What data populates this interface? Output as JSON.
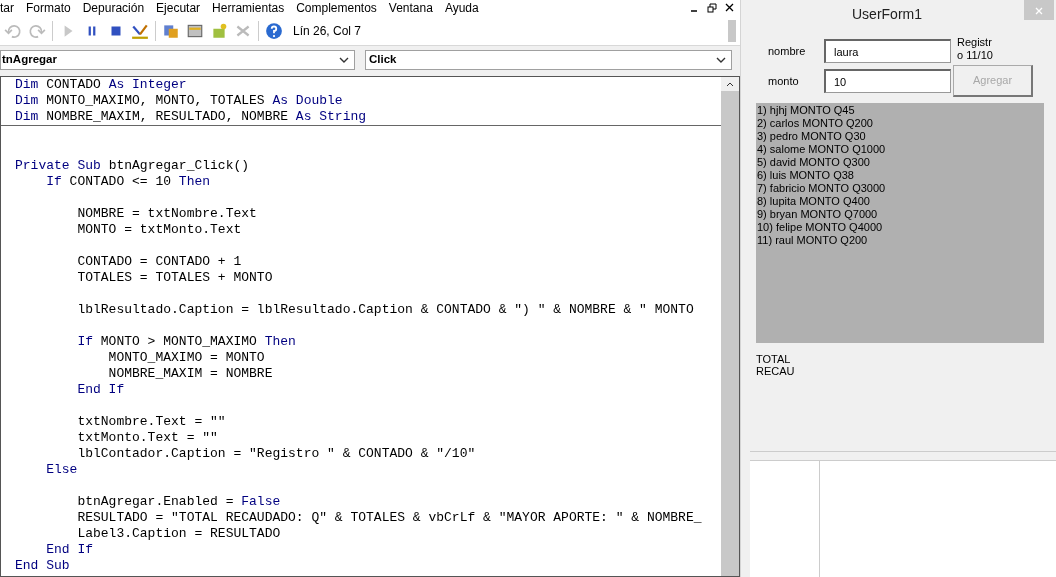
{
  "menu": [
    "tar",
    "Formato",
    "Depuración",
    "Ejecutar",
    "Herramientas",
    "Complementos",
    "Ventana",
    "Ayuda"
  ],
  "toolbar": {
    "position": "Lín 26, Col 7"
  },
  "object_dropdown": {
    "value": "tnAgregar"
  },
  "procedure_dropdown": {
    "value": "Click"
  },
  "code": {
    "declarations": [
      {
        "kind": "code",
        "tokens": [
          {
            "t": "Dim",
            "kind": "keyword"
          },
          {
            "t": " CONTADO ",
            "kind": "plain"
          },
          {
            "t": "As Integer",
            "kind": "keyword"
          }
        ]
      },
      {
        "kind": "code",
        "tokens": [
          {
            "t": "Dim",
            "kind": "keyword"
          },
          {
            "t": " MONTO_MAXIMO, MONTO, TOTALES ",
            "kind": "plain"
          },
          {
            "t": "As Double",
            "kind": "keyword"
          }
        ]
      },
      {
        "kind": "code",
        "tokens": [
          {
            "t": "Dim",
            "kind": "keyword"
          },
          {
            "t": " NOMBRE_MAXIM, RESULTADO, NOMBRE ",
            "kind": "plain"
          },
          {
            "t": "As String",
            "kind": "keyword"
          }
        ]
      }
    ],
    "procedure": [
      {
        "kind": "blank"
      },
      {
        "kind": "blank"
      },
      {
        "kind": "code",
        "tokens": [
          {
            "t": "Private Sub",
            "kind": "keyword"
          },
          {
            "t": " btnAgregar_Click()",
            "kind": "plain"
          }
        ]
      },
      {
        "kind": "code",
        "tokens": [
          {
            "t": "    If",
            "kind": "keyword"
          },
          {
            "t": " CONTADO <= 10 ",
            "kind": "plain"
          },
          {
            "t": "Then",
            "kind": "keyword"
          }
        ]
      },
      {
        "kind": "blank"
      },
      {
        "kind": "code",
        "tokens": [
          {
            "t": "        NOMBRE = txtNombre.Text",
            "kind": "plain"
          }
        ]
      },
      {
        "kind": "code",
        "tokens": [
          {
            "t": "        MONTO = txtMonto.Text",
            "kind": "plain"
          }
        ]
      },
      {
        "kind": "blank"
      },
      {
        "kind": "code",
        "tokens": [
          {
            "t": "        CONTADO = CONTADO + 1",
            "kind": "plain"
          }
        ]
      },
      {
        "kind": "code",
        "tokens": [
          {
            "t": "        TOTALES = TOTALES + MONTO",
            "kind": "plain"
          }
        ]
      },
      {
        "kind": "blank"
      },
      {
        "kind": "code",
        "tokens": [
          {
            "t": "        lblResultado.Caption = lblResultado.Caption & CONTADO & \") \" & NOMBRE & \" MONTO",
            "kind": "plain"
          }
        ]
      },
      {
        "kind": "blank"
      },
      {
        "kind": "code",
        "tokens": [
          {
            "t": "        If",
            "kind": "keyword"
          },
          {
            "t": " MONTO > MONTO_MAXIMO ",
            "kind": "plain"
          },
          {
            "t": "Then",
            "kind": "keyword"
          }
        ]
      },
      {
        "kind": "code",
        "tokens": [
          {
            "t": "            MONTO_MAXIMO = MONTO",
            "kind": "plain"
          }
        ]
      },
      {
        "kind": "code",
        "tokens": [
          {
            "t": "            NOMBRE_MAXIM = NOMBRE",
            "kind": "plain"
          }
        ]
      },
      {
        "kind": "code",
        "tokens": [
          {
            "t": "        End If",
            "kind": "keyword"
          }
        ]
      },
      {
        "kind": "blank"
      },
      {
        "kind": "code",
        "tokens": [
          {
            "t": "        txtNombre.Text = \"\"",
            "kind": "plain"
          }
        ]
      },
      {
        "kind": "code",
        "tokens": [
          {
            "t": "        txtMonto.Text = \"\"",
            "kind": "plain"
          }
        ]
      },
      {
        "kind": "code",
        "tokens": [
          {
            "t": "        lblContador.Caption = \"Registro \" & CONTADO & \"/10\"",
            "kind": "plain"
          }
        ]
      },
      {
        "kind": "code",
        "tokens": [
          {
            "t": "    Else",
            "kind": "keyword"
          }
        ]
      },
      {
        "kind": "blank"
      },
      {
        "kind": "code",
        "tokens": [
          {
            "t": "        btnAgregar.Enabled = ",
            "kind": "plain"
          },
          {
            "t": "False",
            "kind": "keyword"
          }
        ]
      },
      {
        "kind": "code",
        "tokens": [
          {
            "t": "        RESULTADO = \"TOTAL RECAUDADO: Q\" & TOTALES & vbCrLf & \"MAYOR APORTE: \" & NOMBRE_",
            "kind": "plain"
          }
        ]
      },
      {
        "kind": "code",
        "tokens": [
          {
            "t": "        Label3.Caption = RESULTADO",
            "kind": "plain"
          }
        ]
      },
      {
        "kind": "code",
        "tokens": [
          {
            "t": "    End If",
            "kind": "keyword"
          }
        ]
      },
      {
        "kind": "code",
        "tokens": [
          {
            "t": "End Sub",
            "kind": "keyword"
          }
        ]
      }
    ]
  },
  "userform": {
    "title": "UserForm1",
    "fields": [
      {
        "label": "nombre",
        "value": "laura"
      },
      {
        "label": "monto",
        "value": "10"
      }
    ],
    "counter_lines": [
      "Registr",
      "o 11/10"
    ],
    "add_button": {
      "label": "Agregar",
      "disabled": true
    },
    "results": [
      "1) hjhj MONTO Q45",
      "2) carlos MONTO Q200",
      "3) pedro MONTO Q30",
      "4) salome MONTO Q1000",
      "5) david MONTO Q300",
      "6) luis MONTO Q38",
      "7) fabricio MONTO Q3000",
      "8) lupita MONTO Q400",
      "9) bryan MONTO Q7000",
      "10) felipe MONTO Q4000",
      "11) raul MONTO Q200"
    ],
    "total_lines": [
      "TOTAL",
      "RECAU"
    ]
  }
}
